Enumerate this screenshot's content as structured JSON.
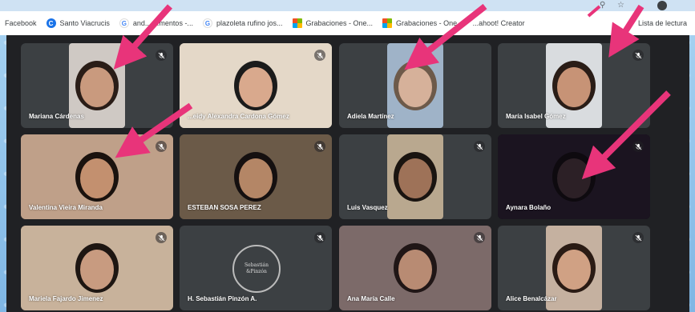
{
  "bookmarks": [
    {
      "label": "Facebook",
      "icon": "facebook-icon"
    },
    {
      "label": "Santo Viacrucis",
      "icon": "chrome-icon"
    },
    {
      "label": "and... ...mentos -...",
      "icon": "google-icon"
    },
    {
      "label": "plazoleta rufino jos...",
      "icon": "google-icon"
    },
    {
      "label": "Grabaciones - One...",
      "icon": "microsoft-icon"
    },
    {
      "label": "Grabaciones - One...",
      "icon": "microsoft-icon"
    },
    {
      "label": "...ahoot! Creator",
      "icon": "kahoot-icon"
    }
  ],
  "reading_list": "Lista de lectura",
  "participants": [
    {
      "name": "Mariana Cárdenas",
      "muted": true
    },
    {
      "name": "...eidy Alexandra Cardona Gómez",
      "muted": true
    },
    {
      "name": "Adiela Martínez",
      "muted": false
    },
    {
      "name": "María Isabel Gómez",
      "muted": true
    },
    {
      "name": "Valentina Vieira Miranda",
      "muted": true
    },
    {
      "name": "ESTEBAN SOSA PEREZ",
      "muted": true
    },
    {
      "name": "Luis Vasquez",
      "muted": true
    },
    {
      "name": "Aynara Bolaño",
      "muted": true
    },
    {
      "name": "Mariela Fajardo Jimenez",
      "muted": true
    },
    {
      "name": "H. Sebastián Pinzón A.",
      "muted": true
    },
    {
      "name": "Ana María Calle",
      "muted": true
    },
    {
      "name": "Alice Benalcázar",
      "muted": true
    }
  ],
  "logo_text": [
    "Sebastián",
    "&Pinzón"
  ],
  "colors": {
    "arrow": "#e8347a",
    "meet_bg": "#202124",
    "tile_bg": "#3c4043"
  }
}
